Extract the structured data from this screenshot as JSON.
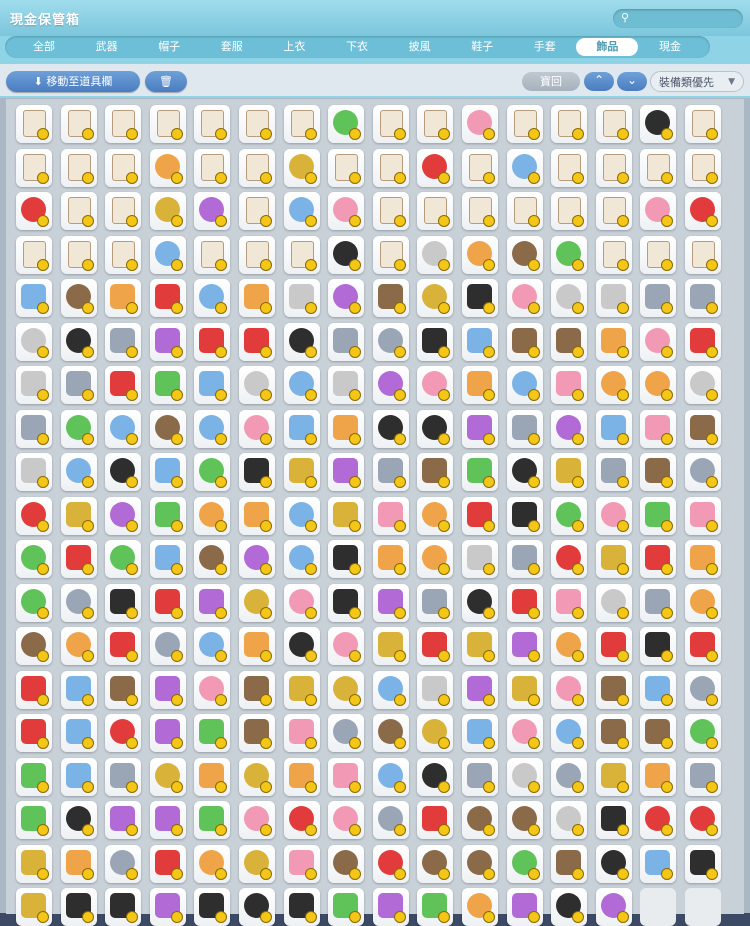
{
  "window": {
    "title": "現金保管箱",
    "search_icon": "search-icon"
  },
  "tabs": [
    {
      "label": "全部",
      "active": false
    },
    {
      "label": "武器",
      "active": false
    },
    {
      "label": "帽子",
      "active": false
    },
    {
      "label": "套服",
      "active": false
    },
    {
      "label": "上衣",
      "active": false
    },
    {
      "label": "下衣",
      "active": false
    },
    {
      "label": "披風",
      "active": false
    },
    {
      "label": "鞋子",
      "active": false
    },
    {
      "label": "手套",
      "active": false
    },
    {
      "label": "飾品",
      "active": true
    },
    {
      "label": "現金",
      "active": false
    }
  ],
  "toolbar": {
    "move_label": "移動至道具欄",
    "move_icon": "download-arrow-icon",
    "delete_icon": "trash-icon",
    "return_label": "寶回",
    "up_icon": "chevron-up-icon",
    "down_icon": "chevron-down-icon",
    "sort_label": "裝備類優先",
    "sort_chevron_icon": "chevron-down-icon"
  },
  "grid": {
    "rows": 19,
    "cols": 16,
    "filled_in_last_row": 14,
    "palette": [
      "#f1e7d6",
      "#9aa6b6",
      "#2e2e2e",
      "#d9b23a",
      "#e23b3b",
      "#7bb3e6",
      "#b16ad6",
      "#5fc35a",
      "#f29ab5",
      "#8b6a4a",
      "#c9c9c9",
      "#f0a44a"
    ]
  },
  "colors": {
    "accent": "#8fd3e6",
    "active_tab_text": "#4f9db5",
    "button_blue": "#4a7dc1",
    "coin": "#f3c617"
  }
}
